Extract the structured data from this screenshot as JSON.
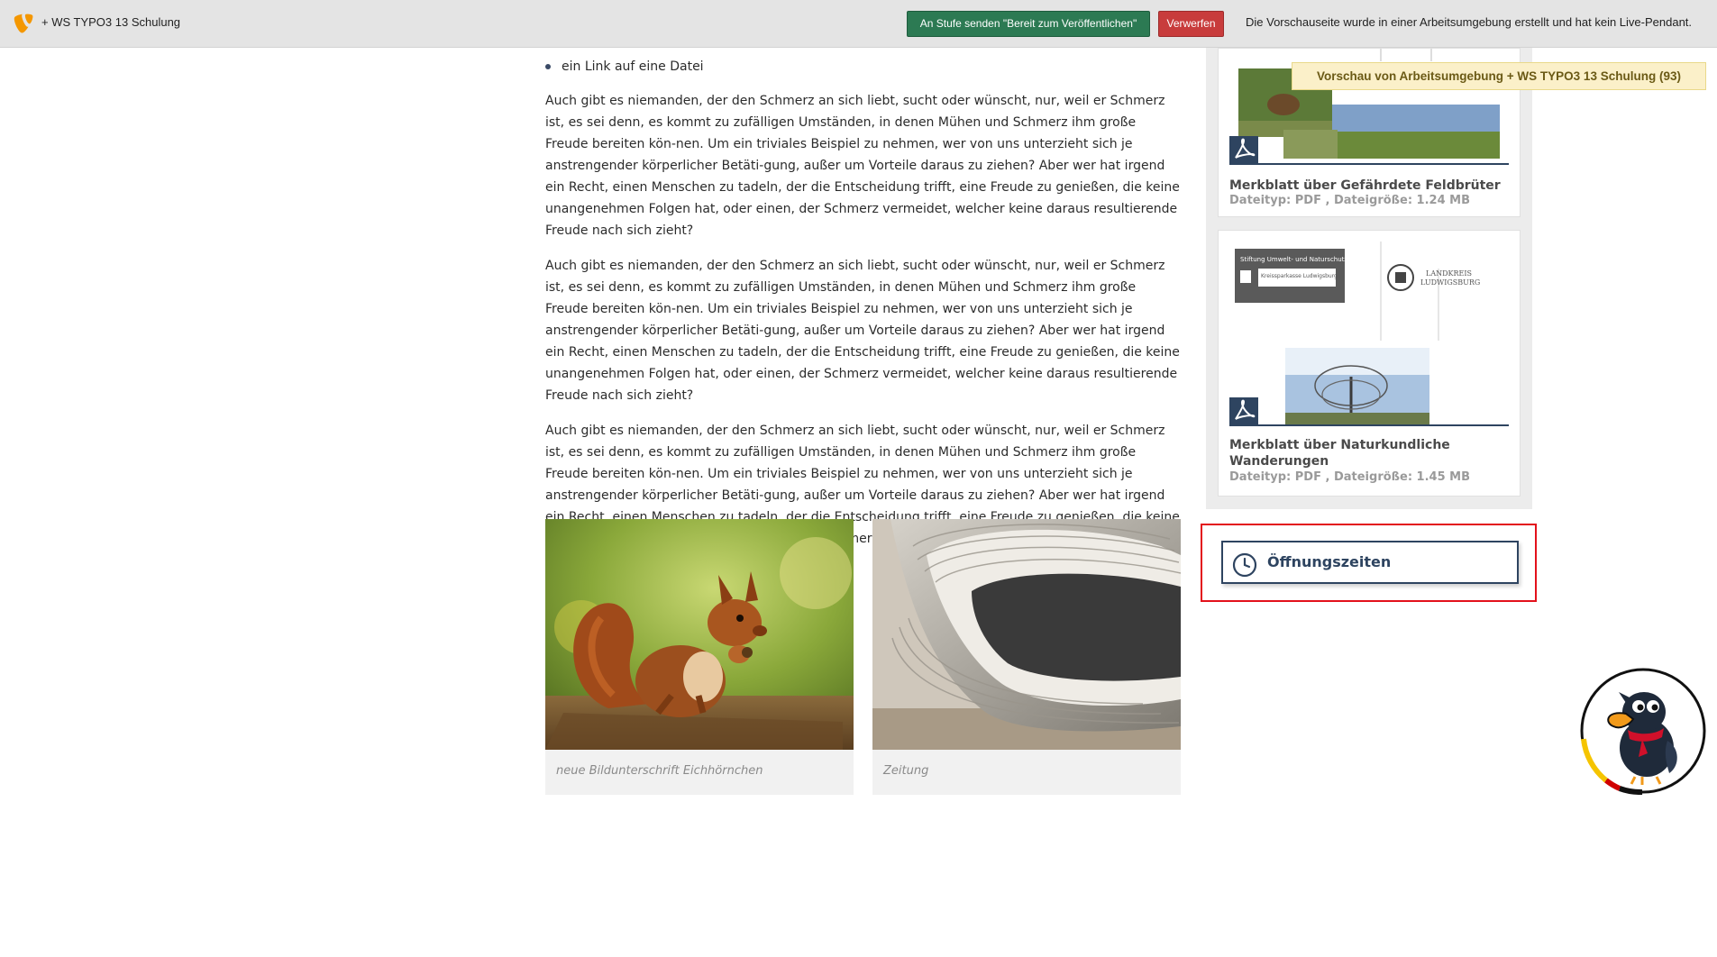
{
  "topbar": {
    "workspace_title": "+ WS TYPO3 13 Schulung",
    "send_button": "An Stufe senden \"Bereit zum Veröffentlichen\"",
    "discard_button": "Verwerfen",
    "info_text": "Die Vorschauseite wurde in einer Arbeitsumgebung erstellt und hat kein Live-Pendant."
  },
  "preview_badge": "Vorschau von Arbeitsumgebung + WS TYPO3 13 Schulung (93)",
  "content": {
    "bullet": "ein Link auf eine Datei",
    "paragraphs": [
      "Auch gibt es niemanden, der den Schmerz an sich liebt, sucht oder wünscht, nur, weil er Schmerz ist, es sei denn, es kommt zu zufälligen Umständen, in denen Mühen und Schmerz ihm große Freude bereiten kön-nen. Um ein triviales Beispiel zu nehmen, wer von uns unterzieht sich je anstrengender körperlicher Betäti-gung, außer um Vorteile daraus zu ziehen? Aber wer hat irgend ein Recht, einen Menschen zu tadeln, der die Entscheidung trifft, eine Freude zu genießen, die keine unangenehmen Folgen hat, oder einen, der Schmerz vermeidet, welcher keine daraus resultierende Freude nach sich zieht?",
      "Auch gibt es niemanden, der den Schmerz an sich liebt, sucht oder wünscht, nur, weil er Schmerz ist, es sei denn, es kommt zu zufälligen Umständen, in denen Mühen und Schmerz ihm große Freude bereiten kön-nen. Um ein triviales Beispiel zu nehmen, wer von uns unterzieht sich je anstrengender körperlicher Betäti-gung, außer um Vorteile daraus zu ziehen? Aber wer hat irgend ein Recht, einen Menschen zu tadeln, der die Entscheidung trifft, eine Freude zu genießen, die keine unangenehmen Folgen hat, oder einen, der Schmerz vermeidet, welcher keine daraus resultierende Freude nach sich zieht?",
      "Auch gibt es niemanden, der den Schmerz an sich liebt, sucht oder wünscht, nur, weil er Schmerz ist, es sei denn, es kommt zu zufälligen Umständen, in denen Mühen und Schmerz ihm große Freude bereiten kön-nen. Um ein triviales Beispiel zu nehmen, wer von uns unterzieht sich je anstrengender körperlicher Betäti-gung, außer um Vorteile daraus zu ziehen? Aber wer hat irgend ein Recht, einen Menschen zu tadeln, der die Entscheidung trifft, eine Freude zu genießen, die keine unangenehmen Folgen hat, oder einen, der Schmerz vermeidet, welcher keine daraus resultierende Freude nach sich zieht?"
    ],
    "figures": [
      {
        "caption": "neue Bildunterschrift Eichhörnchen"
      },
      {
        "caption": "Zeitung"
      }
    ]
  },
  "sidebar": {
    "downloads": [
      {
        "title": "Merkblatt über Gefährdete Feldbrüter",
        "meta": "Dateityp: PDF , Dateigröße: 1.24 MB"
      },
      {
        "title": "Merkblatt über Naturkundliche Wanderungen",
        "meta": "Dateityp: PDF , Dateigröße: 1.45 MB",
        "thumb_text_1": "Stiftung Umwelt- und Naturschutz",
        "thumb_text_2": "Kreissparkasse Ludwigsburg",
        "thumb_text_3": "LANDKREIS LUDWIGSBURG"
      }
    ],
    "hours_label": "Öffnungszeiten"
  },
  "colors": {
    "primary_navy": "#2e4460",
    "send_green": "#2c7a53",
    "discard_red": "#c83c3c",
    "highlight_red": "#e3111b",
    "typo3_orange": "#f49700"
  },
  "icons": {
    "logo": "typo3-logo-icon",
    "pdf": "pdf-icon",
    "clock": "clock-icon",
    "mascot": "raven-mascot-icon"
  }
}
